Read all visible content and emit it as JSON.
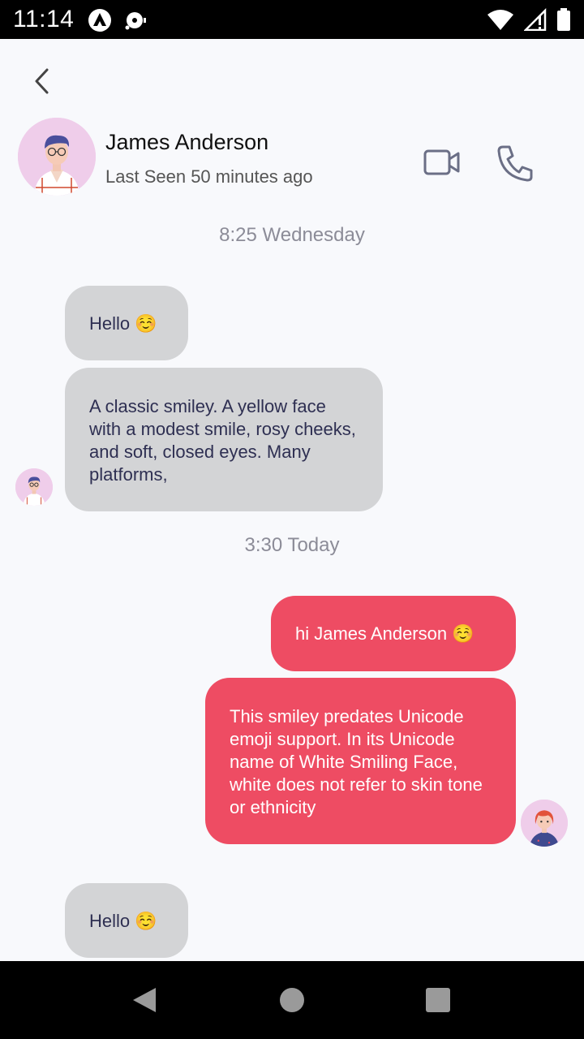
{
  "status_bar": {
    "time": "11:14"
  },
  "header": {
    "contact_name": "James Anderson",
    "last_seen": "Last Seen 50 minutes ago"
  },
  "chat": {
    "timestamps": [
      "8:25 Wednesday",
      "3:30 Today"
    ],
    "messages": [
      {
        "direction": "incoming",
        "text": "Hello ☺️"
      },
      {
        "direction": "incoming",
        "text": "A classic smiley. A yellow face with a modest smile, rosy cheeks, and soft, closed eyes. Many platforms,"
      },
      {
        "direction": "outgoing",
        "text": "hi James Anderson ☺️"
      },
      {
        "direction": "outgoing",
        "text": "This smiley predates Unicode emoji support. In its Unicode name of White Smiling Face, white does not refer to skin tone or ethnicity"
      },
      {
        "direction": "incoming",
        "text": "Hello ☺️"
      }
    ]
  },
  "colors": {
    "incoming_bubble": "#d3d4d6",
    "outgoing_bubble": "#ee4c63",
    "background": "#f8f9fc",
    "icon_stroke": "#6b6f86"
  },
  "icons": [
    "back-arrow-icon",
    "video-camera-icon",
    "phone-icon",
    "avatar"
  ]
}
